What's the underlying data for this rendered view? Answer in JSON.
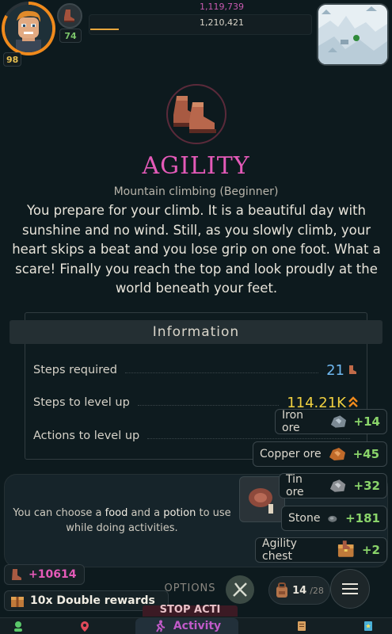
{
  "player": {
    "character_level": "98",
    "skill_level": "74",
    "xp_current": "1,119,739",
    "xp_next": "1,210,421",
    "xp_progress": 0.13
  },
  "activity": {
    "skill_title": "AGILITY",
    "subtitle": "Mountain climbing (Beginner)",
    "description": "You prepare for your climb. It is a beautiful day with sunshine and no wind. Still, as you slowly climb, your heart skips a beat and you lose grip on one foot. What a scare! Finally you reach the top and look proudly at the world beneath your feet."
  },
  "information": {
    "header": "Information",
    "rows": [
      {
        "label": "Steps required",
        "value": "21",
        "color": "#6fb8f0"
      },
      {
        "label": "Steps to level up",
        "value": "114.21K",
        "color": "#f0d040"
      },
      {
        "label": "Actions to level up",
        "value": "",
        "color": "#f0ece2"
      }
    ]
  },
  "consumables": {
    "text_prefix": "You can choose a ",
    "food_word": "food",
    "text_middle": " and a ",
    "potion_word": "potion",
    "text_suffix": " to use while doing activities."
  },
  "loot_toasts": [
    {
      "name": "Iron ore",
      "amount": "+14",
      "icon": "iron-ore-icon"
    },
    {
      "name": "Copper ore",
      "amount": "+45",
      "icon": "copper-ore-icon"
    },
    {
      "name": "Tin ore",
      "amount": "+32",
      "icon": "tin-ore-icon"
    },
    {
      "name": "Stone",
      "amount": "+181",
      "icon": "stone-icon"
    },
    {
      "name": "Agility chest",
      "amount": "+2",
      "icon": "agility-chest-icon"
    }
  ],
  "rewards": {
    "boot_bonus": "+10614",
    "double_rewards": "10x Double rewards"
  },
  "controls": {
    "options_label": "OPTIONS",
    "stop_label": "STOP ACTI",
    "inventory_count": "14",
    "inventory_capacity": "/28"
  },
  "nav": {
    "activity_label": "Activity"
  },
  "colors": {
    "accent_pink": "#e45ab8",
    "gain_green": "#8ad46a",
    "xp_orange": "#f08a1c"
  }
}
